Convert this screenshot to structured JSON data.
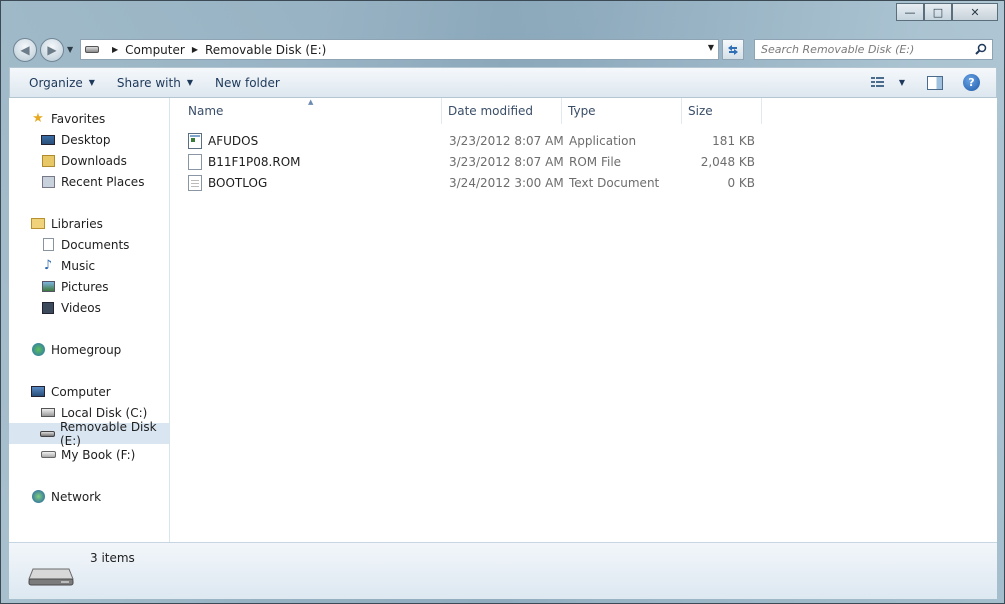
{
  "window": {
    "caption": {
      "minimize": "—",
      "maximize": "□",
      "close": "✕"
    }
  },
  "address_bar": {
    "crumbs": [
      "Computer",
      "Removable Disk (E:)"
    ]
  },
  "search": {
    "placeholder": "Search Removable Disk (E:)"
  },
  "toolbar": {
    "organize_label": "Organize",
    "share_label": "Share with",
    "new_folder_label": "New folder"
  },
  "nav": {
    "favorites": {
      "label": "Favorites",
      "items": [
        {
          "label": "Desktop",
          "icon": "desktop-icon"
        },
        {
          "label": "Downloads",
          "icon": "downloads-icon"
        },
        {
          "label": "Recent Places",
          "icon": "recent-places-icon"
        }
      ]
    },
    "libraries": {
      "label": "Libraries",
      "items": [
        {
          "label": "Documents",
          "icon": "documents-icon"
        },
        {
          "label": "Music",
          "icon": "music-icon"
        },
        {
          "label": "Pictures",
          "icon": "pictures-icon"
        },
        {
          "label": "Videos",
          "icon": "videos-icon"
        }
      ]
    },
    "homegroup": {
      "label": "Homegroup"
    },
    "computer": {
      "label": "Computer",
      "items": [
        {
          "label": "Local Disk (C:)",
          "icon": "local-disk-icon"
        },
        {
          "label": "Removable Disk (E:)",
          "icon": "removable-disk-icon",
          "selected": true
        },
        {
          "label": "My Book (F:)",
          "icon": "external-drive-icon"
        }
      ]
    },
    "network": {
      "label": "Network"
    }
  },
  "columns": {
    "name": "Name",
    "date": "Date modified",
    "type": "Type",
    "size": "Size"
  },
  "files": [
    {
      "name": "AFUDOS",
      "date": "3/23/2012 8:07 AM",
      "type": "Application",
      "size": "181 KB",
      "icon": "application-icon"
    },
    {
      "name": "B11F1P08.ROM",
      "date": "3/23/2012 8:07 AM",
      "type": "ROM File",
      "size": "2,048 KB",
      "icon": "file-icon"
    },
    {
      "name": "BOOTLOG",
      "date": "3/24/2012 3:00 AM",
      "type": "Text Document",
      "size": "0 KB",
      "icon": "text-document-icon"
    }
  ],
  "details": {
    "count": "3 items"
  },
  "colors": {
    "accent": "#1e395b",
    "selection": "#d9e6f2",
    "help": "#1d5aa8"
  }
}
